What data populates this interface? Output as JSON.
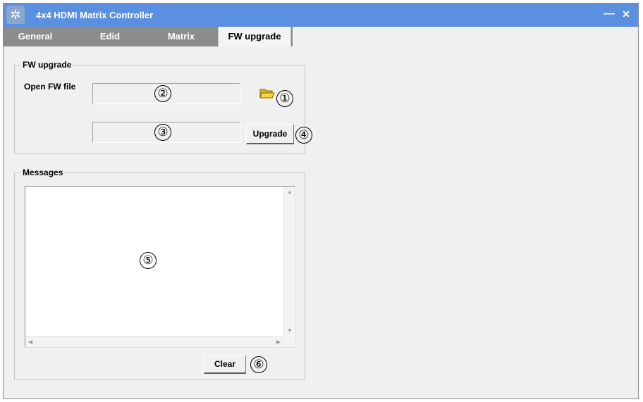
{
  "window": {
    "title": "4x4 HDMI Matrix Controller",
    "app_icon": "gear-icon",
    "minimize_glyph": "—",
    "close_glyph": "✕"
  },
  "tabs": [
    {
      "label": "General",
      "active": false
    },
    {
      "label": "Edid",
      "active": false
    },
    {
      "label": "Matrix",
      "active": false
    },
    {
      "label": "FW upgrade",
      "active": true
    }
  ],
  "fw_group": {
    "title": "FW upgrade",
    "open_label": "Open FW file",
    "file_path_value": "",
    "progress_value": "",
    "folder_icon": "folder-open-icon",
    "upgrade_button": "Upgrade"
  },
  "messages_group": {
    "title": "Messages",
    "content": "",
    "clear_button": "Clear"
  },
  "callouts": [
    "①",
    "②",
    "③",
    "④",
    "⑤",
    "⑥"
  ],
  "colors": {
    "titlebar": "#5b8fe0",
    "tabstrip": "#8c8c8c",
    "window_bg": "#f0f0f0"
  }
}
